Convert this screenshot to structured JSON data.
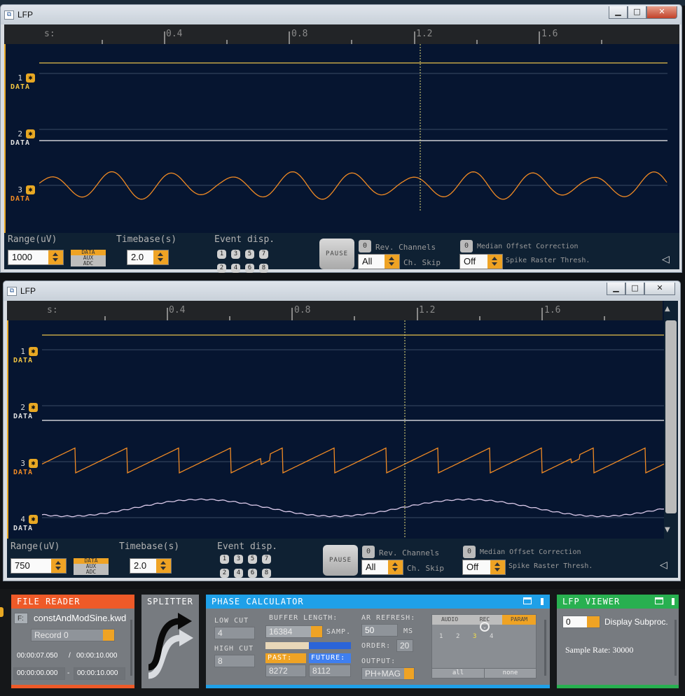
{
  "windows": [
    {
      "title": "LFP",
      "time_ticks": [
        "s:",
        "0.4",
        "0.8",
        "1.2",
        "1.6"
      ],
      "channels": [
        {
          "num": "1",
          "type": "DATA"
        },
        {
          "num": "2",
          "type": "DATA"
        },
        {
          "num": "3",
          "type": "DATA"
        }
      ],
      "controls": {
        "range_label": "Range(uV)",
        "range_value": "1000",
        "type_options": [
          "DATA",
          "AUX",
          "ADC"
        ],
        "timebase_label": "Timebase(s)",
        "timebase_value": "2.0",
        "event_label": "Event disp.",
        "event_buttons": [
          "1",
          "3",
          "5",
          "7",
          "2",
          "4",
          "6",
          "8"
        ],
        "pause_label": "PAUSE",
        "rev_toggle": "0",
        "rev_label": "Rev. Channels",
        "skip_value": "All",
        "skip_label": "Ch. Skip",
        "median_toggle": "0",
        "median_label": "Median Offset Correction",
        "spike_value": "Off",
        "spike_label": "Spike Raster Thresh.",
        "back_arrow": "◁"
      }
    },
    {
      "title": "LFP",
      "time_ticks": [
        "s:",
        "0.4",
        "0.8",
        "1.2",
        "1.6"
      ],
      "channels": [
        {
          "num": "1",
          "type": "DATA"
        },
        {
          "num": "2",
          "type": "DATA"
        },
        {
          "num": "3",
          "type": "DATA"
        },
        {
          "num": "4",
          "type": "DATA"
        }
      ],
      "controls": {
        "range_label": "Range(uV)",
        "range_value": "750",
        "type_options": [
          "DATA",
          "AUX",
          "ADC"
        ],
        "timebase_label": "Timebase(s)",
        "timebase_value": "2.0",
        "event_label": "Event disp.",
        "event_buttons": [
          "1",
          "3",
          "5",
          "7",
          "2",
          "4",
          "6",
          "8"
        ],
        "pause_label": "PAUSE",
        "rev_toggle": "0",
        "rev_label": "Rev. Channels",
        "skip_value": "All",
        "skip_label": "Ch. Skip",
        "median_toggle": "0",
        "median_label": "Median Offset Correction",
        "spike_value": "Off",
        "spike_label": "Spike Raster Thresh.",
        "back_arrow": "◁"
      }
    }
  ],
  "editors": {
    "file_reader": {
      "title": "FILE READER",
      "file_button": "F:",
      "filename": "constAndModSine.kwd",
      "record": "Record 0",
      "current_time": "00:00:07.050",
      "slash": "/",
      "total_time": "00:00:10.000",
      "start_time": "00:00:00.000",
      "dash": "-",
      "end_time": "00:00:10.000"
    },
    "splitter": {
      "title": "SPLITTER"
    },
    "phase_calculator": {
      "title": "PHASE CALCULATOR",
      "low_cut_label": "LOW CUT",
      "low_cut": "4",
      "high_cut_label": "HIGH CUT",
      "high_cut": "8",
      "buffer_label": "BUFFER LENGTH:",
      "buffer_value": "16384",
      "buffer_unit": "SAMP.",
      "past_label": "PAST:",
      "future_label": "FUTURE:",
      "past_value": "8272",
      "future_value": "8112",
      "ar_label": "AR REFRESH:",
      "ar_value": "50",
      "ar_unit": "MS",
      "order_label": "ORDER:",
      "order_value": "20",
      "output_label": "OUTPUT:",
      "output_value": "PH+MAG",
      "tabs": [
        "AUDIO",
        "REC",
        "PARAM"
      ],
      "channels": [
        "1",
        "2",
        "3",
        "4"
      ],
      "all_button": "all",
      "none_button": "none"
    },
    "lfp_viewer": {
      "title": "LFP VIEWER",
      "subproc_value": "0",
      "subproc_label": "Display Subproc.",
      "sample_rate": "Sample Rate: 30000"
    }
  },
  "colors": {
    "plot_bg": "#061530",
    "trace_orange": "#f08a24",
    "trace_yellow": "#e8c14a",
    "trace_white": "#f2f2f2",
    "trace_pink": "#d9c8e8",
    "file_reader_header": "#ee5a28",
    "phase_calc_header": "#1fa0e8",
    "lfp_viewer_header": "#28b050"
  }
}
